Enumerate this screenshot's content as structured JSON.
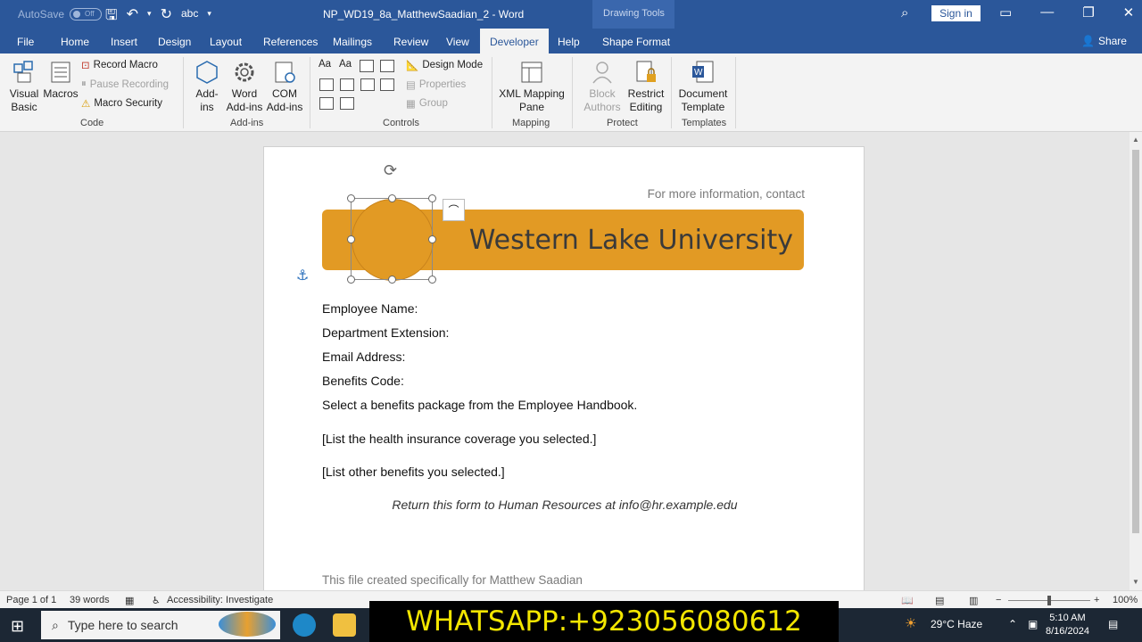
{
  "titlebar": {
    "autosave_label": "AutoSave",
    "autosave_state": "Off",
    "doc_title": "NP_WD19_8a_MatthewSaadian_2  -  Word",
    "context_group": "Drawing Tools",
    "signin_label": "Sign in"
  },
  "tabs": [
    "File",
    "Home",
    "Insert",
    "Design",
    "Layout",
    "References",
    "Mailings",
    "Review",
    "View",
    "Developer",
    "Help",
    "Shape Format"
  ],
  "active_tab": "Developer",
  "share_label": "Share",
  "ribbon": {
    "code": {
      "visual_basic": "Visual Basic",
      "visual_basic_l1": "Visual",
      "visual_basic_l2": "Basic",
      "macros": "Macros",
      "record_macro": "Record Macro",
      "pause_recording": "Pause Recording",
      "macro_security": "Macro Security",
      "label": "Code"
    },
    "addins": {
      "addins_l1": "Add-",
      "addins_l2": "ins",
      "word_l1": "Word",
      "word_l2": "Add-ins",
      "com_l1": "COM",
      "com_l2": "Add-ins",
      "label": "Add-ins"
    },
    "controls": {
      "design_mode": "Design Mode",
      "properties": "Properties",
      "group": "Group",
      "label": "Controls"
    },
    "mapping": {
      "xml_l1": "XML Mapping",
      "xml_l2": "Pane",
      "label": "Mapping"
    },
    "protect": {
      "block_l1": "Block",
      "block_l2": "Authors",
      "restrict_l1": "Restrict",
      "restrict_l2": "Editing",
      "label": "Protect"
    },
    "templates": {
      "doc_l1": "Document",
      "doc_l2": "Template",
      "label": "Templates"
    }
  },
  "document": {
    "contact": "For more information, contact",
    "banner_title": "Western Lake University",
    "fields": [
      "Employee Name:",
      "Department Extension:",
      "Email Address:",
      "Benefits Code:"
    ],
    "instruction": "Select a benefits package from the Employee Handbook.",
    "placeholder1": "[List the health insurance coverage you selected.]",
    "placeholder2": "[List other benefits you selected.]",
    "return_note": "Return this form to Human Resources at info@hr.example.edu",
    "footer_note": "This file created specifically for Matthew Saadian"
  },
  "status": {
    "page": "Page 1 of 1",
    "words": "39 words",
    "accessibility": "Accessibility: Investigate",
    "zoom": "100%"
  },
  "taskbar": {
    "search_placeholder": "Type here to search",
    "weather": "29°C  Haze",
    "time": "5:10 AM",
    "date": "8/16/2024"
  },
  "overlay_text": "WHATSAPP:+923056080612",
  "colors": {
    "word_blue": "#2b579a",
    "banner_orange": "#e29a24",
    "overlay_yellow": "#f3e600"
  }
}
